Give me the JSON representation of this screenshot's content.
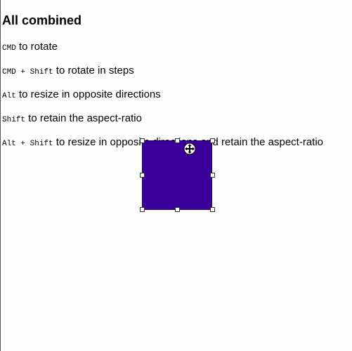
{
  "heading": "All combined",
  "rows": [
    {
      "keys": [
        "CMD"
      ],
      "text": " to rotate"
    },
    {
      "keys": [
        "CMD",
        "Shift"
      ],
      "text": " to rotate in steps"
    },
    {
      "keys": [
        "Alt"
      ],
      "text": " to resize in opposite directions"
    },
    {
      "keys": [
        "Shift"
      ],
      "text": " to retain the aspect-ratio"
    },
    {
      "keys": [
        "Alt",
        "Shift"
      ],
      "text": " to resize in opposite directions and retain the aspect-ratio"
    }
  ],
  "key_separator": " + ",
  "box": {
    "color": "#3a0099"
  },
  "cursor_icon": "move-cursor-icon"
}
